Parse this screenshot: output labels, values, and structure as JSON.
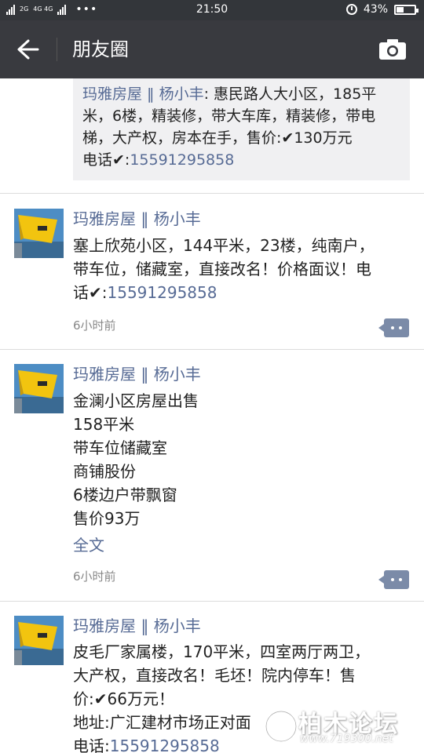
{
  "status_bar": {
    "net_top": "2G",
    "net_mid": "4G 4G",
    "dots": "•••",
    "time": "21:50",
    "battery": "43%",
    "battery_level": 0.43
  },
  "header": {
    "title": "朋友圈"
  },
  "link_card": {
    "author": "玛雅房屋 ‖ 杨小丰",
    "lines": [
      ": 惠民路人大小区，185平",
      "米，6楼，精装修，带大车库，精装修，带电",
      "梯，大产权，房本在手，售价:✔130万元",
      "电话✔:"
    ],
    "phone": "15591295858"
  },
  "posts": [
    {
      "author": "玛雅房屋 ‖ 杨小丰",
      "lines": [
        "塞上欣苑小区，144平米，23楼，纯南户，",
        "带车位，储藏室，直接改名！价格面议！电",
        "话✔:"
      ],
      "phone": "15591295858",
      "time": "6小时前"
    },
    {
      "author": "玛雅房屋 ‖ 杨小丰",
      "lines": [
        "金澜小区房屋出售",
        "158平米",
        "带车位储藏室",
        "商铺股份",
        "6楼边户带飘窗",
        "售价93万"
      ],
      "full_text": "全文",
      "time": "6小时前"
    },
    {
      "author": "玛雅房屋 ‖ 杨小丰",
      "lines": [
        "皮毛厂家属楼，170平米，四室两厅两卫，",
        "大产权，直接改名！毛坯！院内停车！售",
        "价:✔66万元！",
        "地址:广汇建材市场正对面",
        "电话:"
      ],
      "phone": "15591295858"
    }
  ],
  "watermark": {
    "name": "柏木论坛",
    "url": "www.719300.net"
  },
  "colors": {
    "header_bg": "#393a3f",
    "status_bg": "#33363a",
    "link_blue": "#576b95",
    "card_bg": "#f0f0f2"
  }
}
